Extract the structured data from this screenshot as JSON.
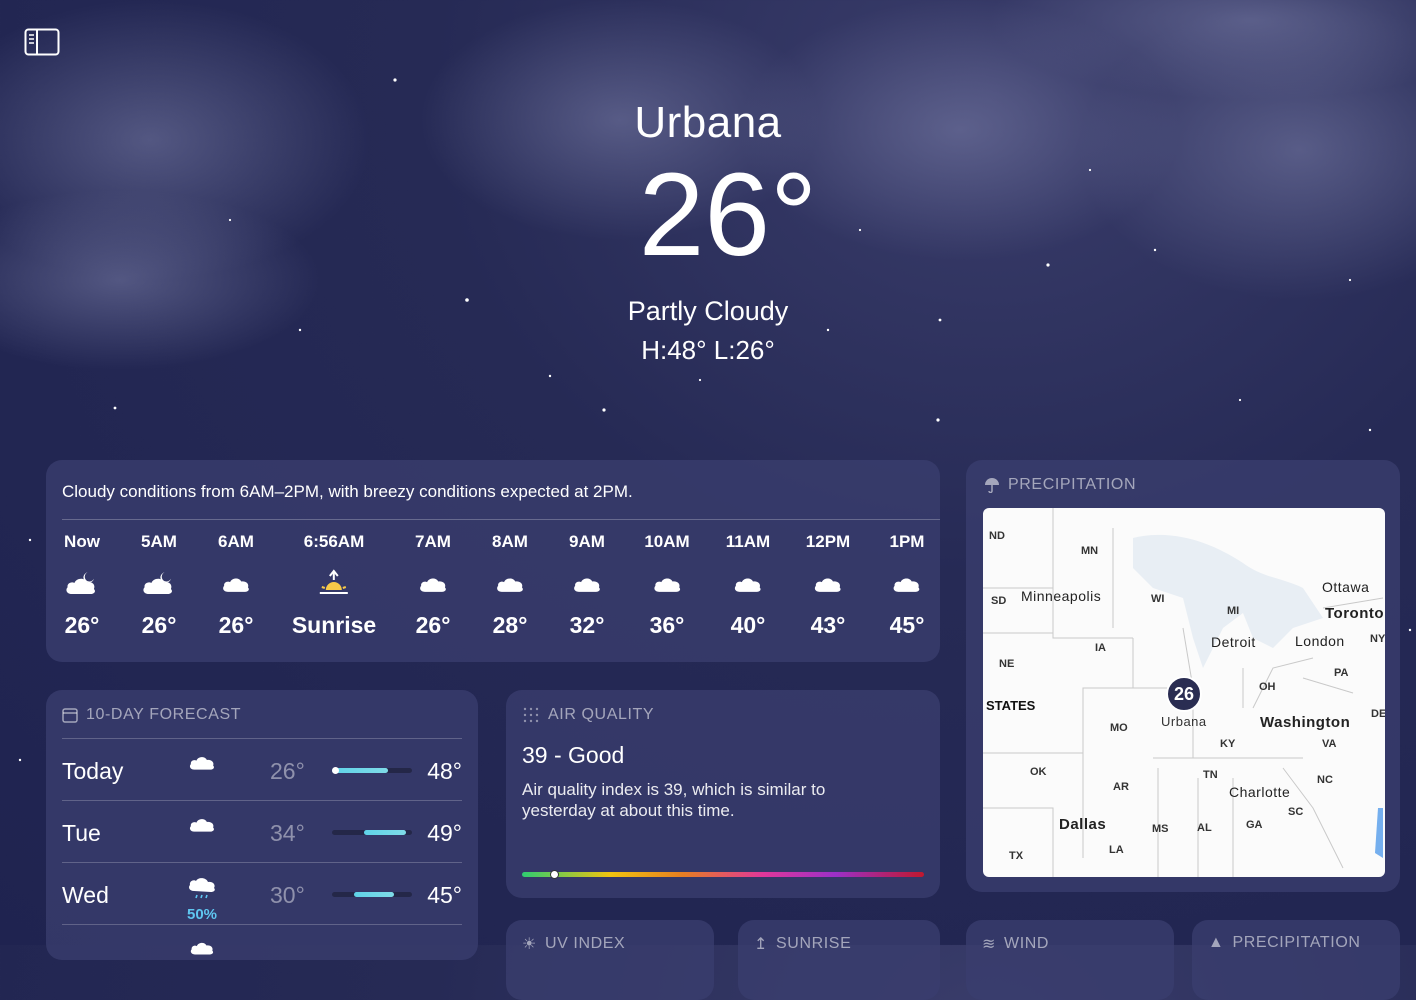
{
  "location": {
    "city": "Urbana",
    "temperature": "26°",
    "condition": "Partly Cloudy",
    "high_low": "H:48°  L:26°"
  },
  "hourly": {
    "summary": "Cloudy conditions from 6AM–2PM, with breezy conditions expected at 2PM.",
    "items": [
      {
        "label": "Now",
        "icon": "partly-cloudy-night-icon",
        "temp": "26°"
      },
      {
        "label": "5AM",
        "icon": "partly-cloudy-night-icon",
        "temp": "26°"
      },
      {
        "label": "6AM",
        "icon": "cloud-icon",
        "temp": "26°"
      },
      {
        "label": "6:56AM",
        "icon": "sunrise-icon",
        "temp": "Sunrise"
      },
      {
        "label": "7AM",
        "icon": "cloud-icon",
        "temp": "26°"
      },
      {
        "label": "8AM",
        "icon": "cloud-icon",
        "temp": "28°"
      },
      {
        "label": "9AM",
        "icon": "cloud-icon",
        "temp": "32°"
      },
      {
        "label": "10AM",
        "icon": "cloud-icon",
        "temp": "36°"
      },
      {
        "label": "11AM",
        "icon": "cloud-icon",
        "temp": "40°"
      },
      {
        "label": "12PM",
        "icon": "cloud-icon",
        "temp": "43°"
      },
      {
        "label": "1PM",
        "icon": "cloud-icon",
        "temp": "45°"
      }
    ]
  },
  "forecast": {
    "title": "10-DAY FORECAST",
    "days": [
      {
        "day": "Today",
        "icon": "cloud-icon",
        "precip": "",
        "low": "26°",
        "high": "48°",
        "range_start": 0.0,
        "range_end": 0.7,
        "current": 0.0
      },
      {
        "day": "Tue",
        "icon": "cloud-icon",
        "precip": "",
        "low": "34°",
        "high": "49°",
        "range_start": 0.4,
        "range_end": 0.92
      },
      {
        "day": "Wed",
        "icon": "rain-cloud-icon",
        "precip": "50%",
        "low": "30°",
        "high": "45°",
        "range_start": 0.28,
        "range_end": 0.78
      }
    ]
  },
  "air_quality": {
    "title": "AIR QUALITY",
    "value": "39 - Good",
    "description": "Air quality index is 39, which is similar to yesterday at about this time.",
    "index_fraction": 0.08
  },
  "precipitation": {
    "title": "PRECIPITATION",
    "marker_value": "26",
    "marker_city": "Urbana",
    "states": [
      "ND",
      "MN",
      "SD",
      "WI",
      "MI",
      "NE",
      "IA",
      "OH",
      "PA",
      "NY",
      "MO",
      "KY",
      "VA",
      "DE",
      "OK",
      "AR",
      "TN",
      "NC",
      "SC",
      "MS",
      "AL",
      "GA",
      "LA",
      "TX"
    ],
    "cities": [
      "Minneapolis",
      "Ottawa",
      "Toronto",
      "Detroit",
      "London",
      "Washington",
      "Charlotte",
      "Dallas"
    ],
    "country_label": "STATES"
  },
  "bottom_cards": [
    "UV INDEX",
    "SUNRISE",
    "WIND",
    "PRECIPITATION"
  ]
}
